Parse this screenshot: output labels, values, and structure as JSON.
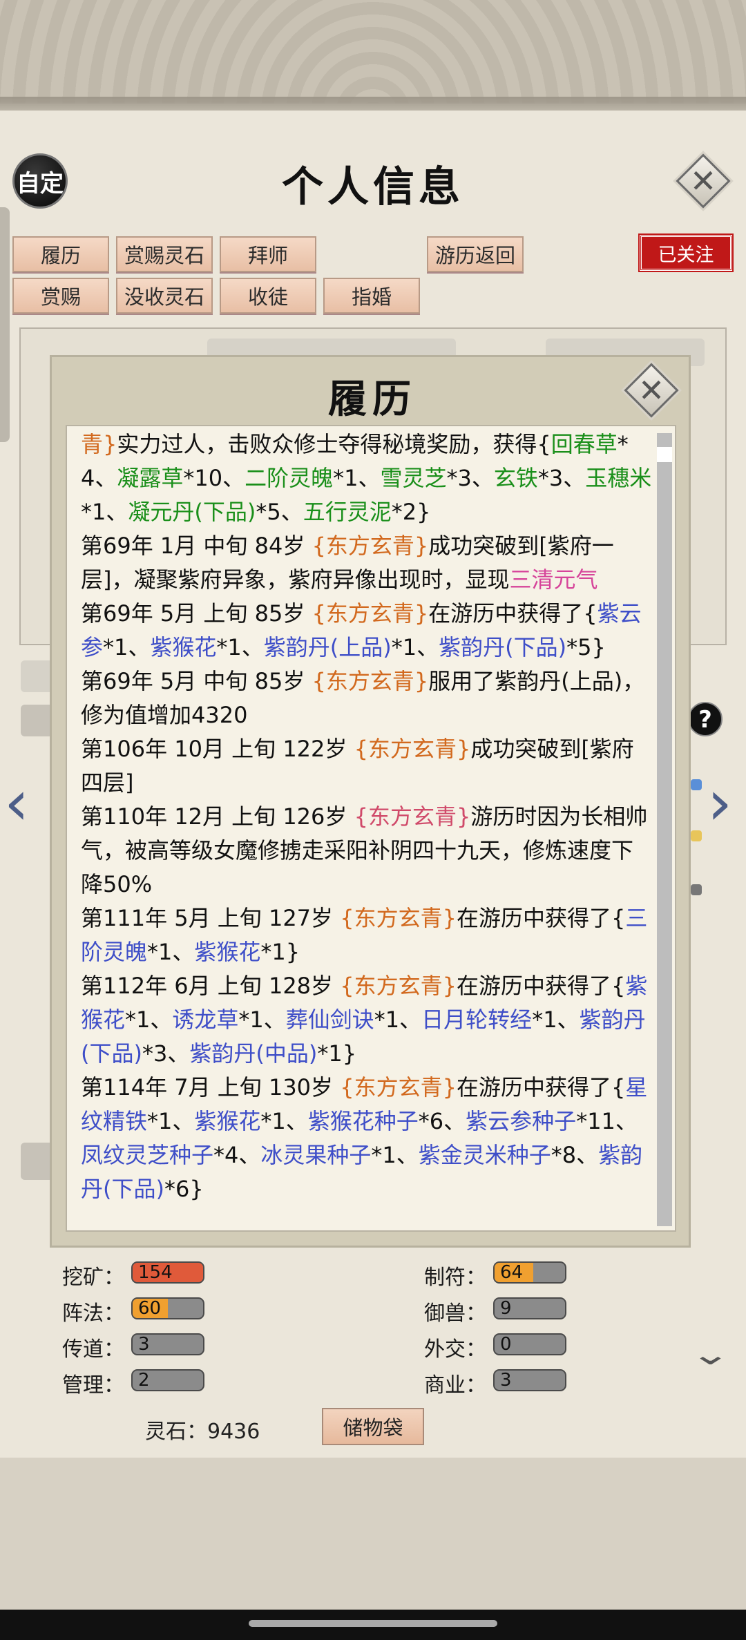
{
  "header": {
    "custom_label": "自定",
    "title": "个人信息"
  },
  "tabs": {
    "row1": [
      {
        "label": "履历"
      },
      {
        "label": "赏赐灵石"
      },
      {
        "label": "拜师"
      },
      {
        "label": "游历返回"
      }
    ],
    "row2": [
      {
        "label": "赏赐"
      },
      {
        "label": "没收灵石"
      },
      {
        "label": "收徒"
      },
      {
        "label": "指婚"
      }
    ],
    "followed_label": "已关注"
  },
  "modal": {
    "title": "履历",
    "entries": [
      [
        "青}",
        "实力过人，击败众修士夺得秘境奖励，获得{",
        "回春草",
        "*4、",
        "凝露草",
        "*10、",
        "二阶灵魄",
        "*1、",
        "雪灵芝",
        "*3、",
        "玄铁",
        "*3、",
        "玉穗米",
        "*1、",
        "凝元丹(下品)",
        "*5、",
        "五行灵泥",
        "*2}"
      ],
      [
        "第69年 1月 中旬  84岁  ",
        "{东方玄青}",
        "成功突破到[紫府一层]，凝聚紫府异象，紫府异像出现时，显现",
        "三清元气"
      ],
      [
        "第69年 5月 上旬 85岁 ",
        "{东方玄青}",
        "在游历中获得了{",
        "紫云参",
        "*1、",
        "紫猴花",
        "*1、",
        "紫韵丹(上品)",
        "*1、",
        "紫韵丹(下品)",
        "*5}"
      ],
      [
        "第69年  5月  中旬   85岁   ",
        "{东方玄青}",
        "服用了紫韵丹(上品)，修为值增加4320"
      ],
      [
        "第106年 10月 上旬 122岁 ",
        "{东方玄青}",
        "成功突破到[紫府四层]"
      ],
      [
        "第110年 12月 上旬  126岁  ",
        "{东方玄青}",
        "游历时因为长相帅气，被高等级女魔修掳走采阳补阴四十九天，修炼速度下降50%"
      ],
      [
        "第111年 5月 上旬  127岁  ",
        "{东方玄青}",
        "在游历中获得了{",
        "三阶灵魄",
        "*1、",
        "紫猴花",
        "*1}"
      ],
      [
        "第112年 6月 上旬  128岁  ",
        "{东方玄青}",
        "在游历中获得了{",
        "紫猴花",
        "*1、",
        "诱龙草",
        "*1、",
        "葬仙剑诀",
        "*1、",
        "日月轮转经",
        "*1、",
        "紫韵丹(下品)",
        "*3、",
        "紫韵丹(中品)",
        "*1}"
      ],
      [
        "第114年 7月 上旬  130岁  ",
        "{东方玄青}",
        "在游历中获得了{",
        "星纹精铁",
        "*1、",
        "紫猴花",
        "*1、",
        "紫猴花种子",
        "*6、",
        "紫云参种子",
        "*11、",
        "凤纹灵芝种子",
        "*4、",
        "冰灵果种子",
        "*1、",
        "紫金灵米种子",
        "*8、",
        "紫韵丹(下品)",
        "*6}"
      ]
    ]
  },
  "attributes": [
    {
      "label": "挖矿：",
      "value": "154",
      "level": 1.0,
      "color": "#e05a3a"
    },
    {
      "label": "制符：",
      "value": "64",
      "level": 0.55,
      "color": "#f0a030"
    },
    {
      "label": "阵法：",
      "value": "60",
      "level": 0.5,
      "color": "#f0a030"
    },
    {
      "label": "御兽：",
      "value": "9",
      "level": 0,
      "color": "#888888"
    },
    {
      "label": "传道：",
      "value": "3",
      "level": 0,
      "color": "#888888"
    },
    {
      "label": "外交：",
      "value": "0",
      "level": 0,
      "color": "#888888"
    },
    {
      "label": "管理：",
      "value": "2",
      "level": 0,
      "color": "#888888"
    },
    {
      "label": "商业：",
      "value": "3",
      "level": 0,
      "color": "#888888"
    }
  ],
  "footer": {
    "stone_text": "灵石：9436",
    "storage_label": "储物袋"
  },
  "icons": {
    "close": "close-icon",
    "modal_close": "close-icon",
    "nav_left": "chevron-left-icon",
    "nav_right": "chevron-right-icon",
    "help": "help-icon",
    "scroll_down": "chevron-down-icon"
  }
}
